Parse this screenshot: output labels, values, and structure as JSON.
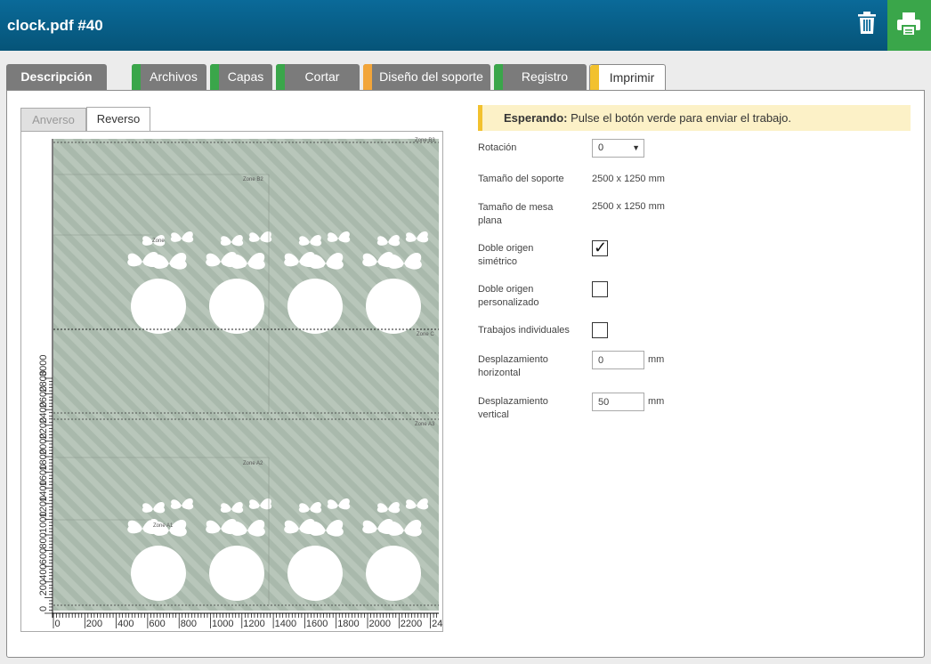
{
  "window": {
    "title": "clock.pdf #40"
  },
  "icons": {
    "trash": "trash-icon",
    "print": "printer-icon"
  },
  "colors": {
    "accent": "#065a82",
    "green": "#3aa64a",
    "orange": "#f2a53a",
    "yellow": "#f2c12e"
  },
  "tabs": [
    {
      "label": "Descripción",
      "mark": ""
    },
    {
      "label": "Archivos",
      "mark": "#3aa64a"
    },
    {
      "label": "Capas",
      "mark": "#3aa64a"
    },
    {
      "label": "Cortar",
      "mark": "#3aa64a"
    },
    {
      "label": "Diseño del soporte",
      "mark": "#f2a53a"
    },
    {
      "label": "Registro",
      "mark": "#3aa64a"
    },
    {
      "label": "Imprimir",
      "mark": "#f2c12e"
    }
  ],
  "preview": {
    "tabs": [
      "Anverso",
      "Reverso"
    ],
    "y_ticks": [
      "0",
      "200",
      "400",
      "600",
      "800",
      "1000",
      "1200",
      "1400",
      "1600",
      "1800",
      "2000",
      "2200",
      "2400",
      "2600",
      "2800",
      "3000"
    ],
    "x_ticks": [
      "0",
      "200",
      "400",
      "600",
      "800",
      "1000",
      "1200",
      "1400",
      "1600",
      "1800",
      "2000",
      "2200",
      "24"
    ],
    "zones": [
      "Zone B3",
      "Zone B2",
      "Zone",
      "Zone C",
      "Zone A3",
      "Zone A2",
      "Zone A1"
    ]
  },
  "status": {
    "bold": "Esperando:",
    "text": " Pulse el botón verde para enviar el trabajo."
  },
  "form": {
    "rotation_label": "Rotación",
    "rotation_value": "0",
    "media_size_label": "Tamaño del soporte",
    "media_size_value": "2500 x 1250 mm",
    "table_size_label_1": "Tamaño de mesa",
    "table_size_label_2": "plana",
    "table_size_value": "2500 x 1250 mm",
    "sym_label_1": "Doble origen",
    "sym_label_2": "simétrico",
    "sym_checked": true,
    "custom_label_1": "Doble origen",
    "custom_label_2": "personalizado",
    "custom_checked": false,
    "individual_label": "Trabajos individuales",
    "individual_checked": false,
    "hshift_label_1": "Desplazamiento",
    "hshift_label_2": "horizontal",
    "hshift_value": "0",
    "vshift_label_1": "Desplazamiento",
    "vshift_label_2": "vertical",
    "vshift_value": "50",
    "unit": "mm"
  }
}
